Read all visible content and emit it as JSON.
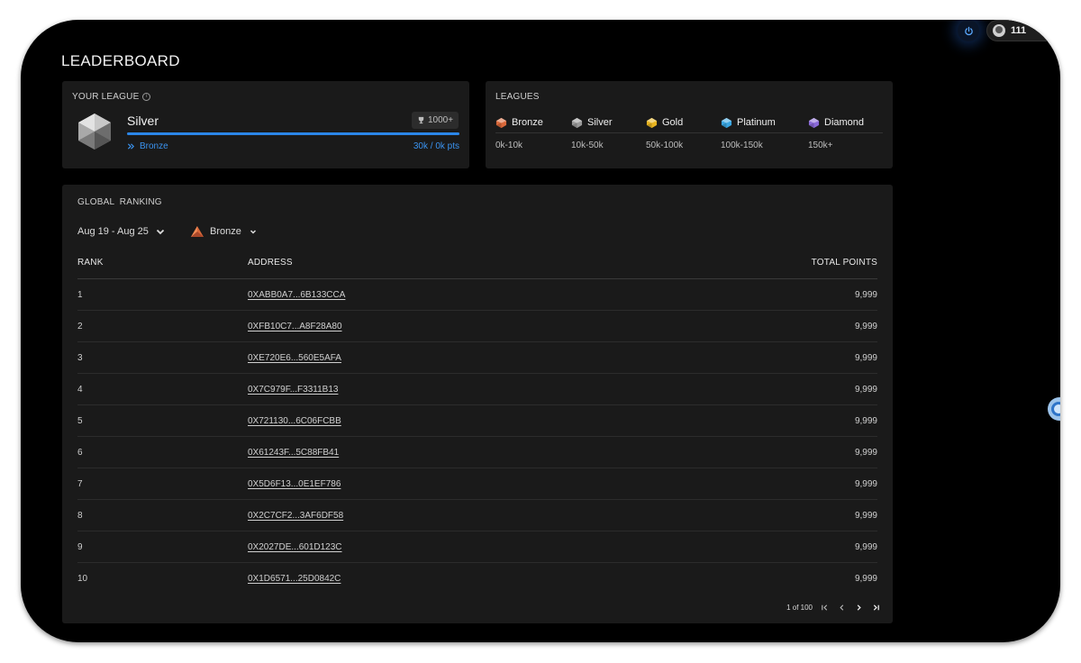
{
  "page": {
    "title": "LEADERBOARD"
  },
  "header": {
    "user_points": "111"
  },
  "your_league": {
    "label": "YOUR LEAGUE",
    "name": "Silver",
    "points_badge": "1000+",
    "progress": 1.0,
    "next_league": "Bronze",
    "points_progress": "30k / 0k pts"
  },
  "leagues": {
    "label": "LEAGUES",
    "items": [
      {
        "name": "Bronze",
        "range": "0k-10k",
        "icon": "bronze-gem-icon",
        "color": "#d9683a"
      },
      {
        "name": "Silver",
        "range": "10k-50k",
        "icon": "silver-gem-icon",
        "color": "#9a9a9a"
      },
      {
        "name": "Gold",
        "range": "50k-100k",
        "icon": "gold-gem-icon",
        "color": "#e8b420"
      },
      {
        "name": "Platinum",
        "range": "100k-150k",
        "icon": "platinum-gem-icon",
        "color": "#3aa6e2"
      },
      {
        "name": "Diamond",
        "range": "150k+",
        "icon": "diamond-gem-icon",
        "color": "#8a6ad8"
      }
    ]
  },
  "ranking": {
    "label": "GLOBAL  RANKING",
    "week_filter": "Aug 19 - Aug 25",
    "league_filter": "Bronze",
    "columns": {
      "rank": "RANK",
      "address": "ADDRESS",
      "points": "TOTAL POINTS"
    },
    "rows": [
      {
        "rank": "1",
        "address": "0XABB0A7...6B133CCA",
        "points": "9,999"
      },
      {
        "rank": "2",
        "address": "0XFB10C7...A8F28A80",
        "points": "9,999"
      },
      {
        "rank": "3",
        "address": "0XE720E6...560E5AFA",
        "points": "9,999"
      },
      {
        "rank": "4",
        "address": "0X7C979F...F3311B13",
        "points": "9,999"
      },
      {
        "rank": "5",
        "address": "0X721130...6C06FCBB",
        "points": "9,999"
      },
      {
        "rank": "6",
        "address": "0X61243F...5C88FB41",
        "points": "9,999"
      },
      {
        "rank": "7",
        "address": "0X5D6F13...0E1EF786",
        "points": "9,999"
      },
      {
        "rank": "8",
        "address": "0X2C7CF2...3AF6DF58",
        "points": "9,999"
      },
      {
        "rank": "9",
        "address": "0X2027DE...601D123C",
        "points": "9,999"
      },
      {
        "rank": "10",
        "address": "0X1D6571...25D0842C",
        "points": "9,999"
      }
    ],
    "pagination": "1 of 100"
  },
  "colors": {
    "accent": "#2b86e8",
    "card_bg": "#1a1a1a",
    "page_bg": "#000000"
  }
}
